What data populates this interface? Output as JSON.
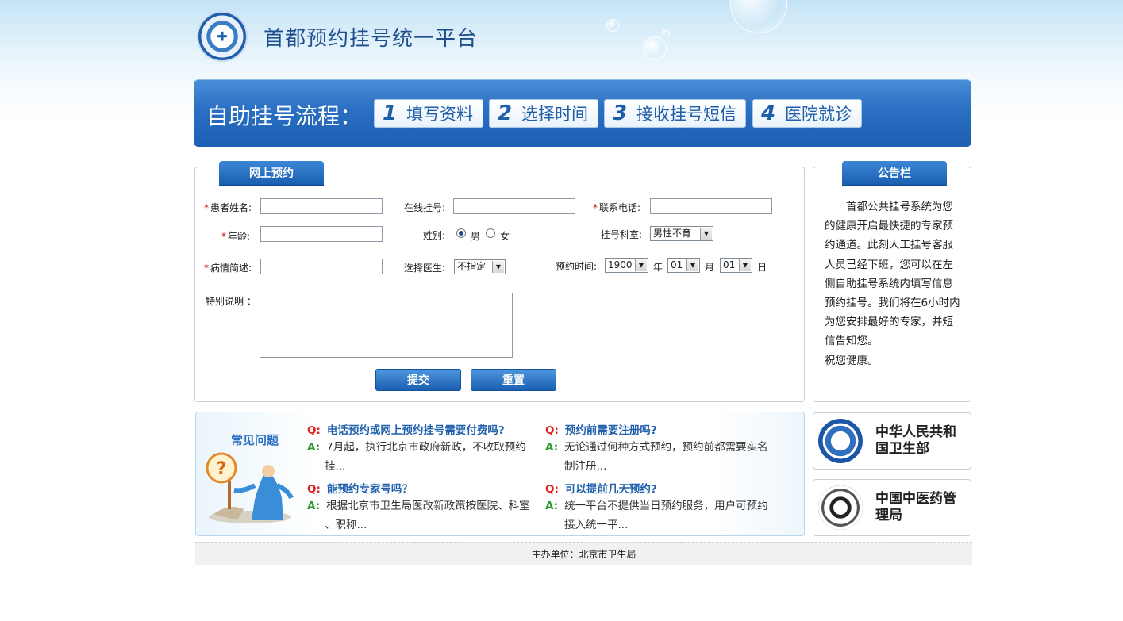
{
  "header": {
    "title": "首都预约挂号统一平台",
    "logo_icon": "health-bureau-emblem"
  },
  "process": {
    "title": "自助挂号流程：",
    "steps": [
      {
        "num": "1",
        "label": "填写资料"
      },
      {
        "num": "2",
        "label": "选择时间"
      },
      {
        "num": "3",
        "label": "接收挂号短信"
      },
      {
        "num": "4",
        "label": "医院就诊"
      }
    ]
  },
  "form": {
    "heading": "网上预约",
    "patient_name_label": "患者姓名:",
    "online_number_label": "在线挂号:",
    "phone_label": "联系电话:",
    "age_label": "年龄:",
    "gender_label": "姓别:",
    "gender_male": "男",
    "gender_female": "女",
    "gender_selected": "男",
    "department_label": "挂号科室:",
    "department_value": "男性不育",
    "condition_label": "病情简述:",
    "doctor_label": "选择医生:",
    "doctor_value": "不指定",
    "time_label": "预约时间:",
    "year_value": "1900",
    "year_unit": "年",
    "month_value": "01",
    "month_unit": "月",
    "day_value": "01",
    "day_unit": "日",
    "remark_label": "特别说明 ：",
    "submit_label": "提交",
    "reset_label": "重置"
  },
  "notice": {
    "heading": "公告栏",
    "body": "首都公共挂号系统为您的健康开启最快捷的专家预约通道。此刻人工挂号客服人员已经下班，您可以在左侧自助挂号系统内填写信息预约挂号。我们将在6小时内为您安排最好的专家，并短信告知您。",
    "closing": "祝您健康。"
  },
  "faq": {
    "title": "常见问题",
    "q_marker": "Q:",
    "a_marker": "A:",
    "items": [
      {
        "q": "电话预约或网上预约挂号需要付费吗?",
        "a1": "7月起，执行北京市政府新政，不收取预约",
        "a2": "挂..."
      },
      {
        "q": "预约前需要注册吗?",
        "a1": "无论通过何种方式预约，预约前都需要实名",
        "a2": "制注册..."
      },
      {
        "q": "能预约专家号吗？",
        "a1": "根据北京市卫生局医改新政策按医院、科室",
        "a2": "、职称..."
      },
      {
        "q": "可以提前几天预约?",
        "a1": "统一平台不提供当日预约服务，用户可预约",
        "a2": "接入统一平..."
      }
    ]
  },
  "partners": [
    {
      "line1": "中华人民共和",
      "line2": "国卫生部",
      "icon": "ministry-of-health-emblem"
    },
    {
      "line1": "中国中医药管",
      "line2": "理局",
      "icon": "tcm-administration-emblem"
    }
  ],
  "footer": {
    "text": "主办单位：北京市卫生局"
  }
}
